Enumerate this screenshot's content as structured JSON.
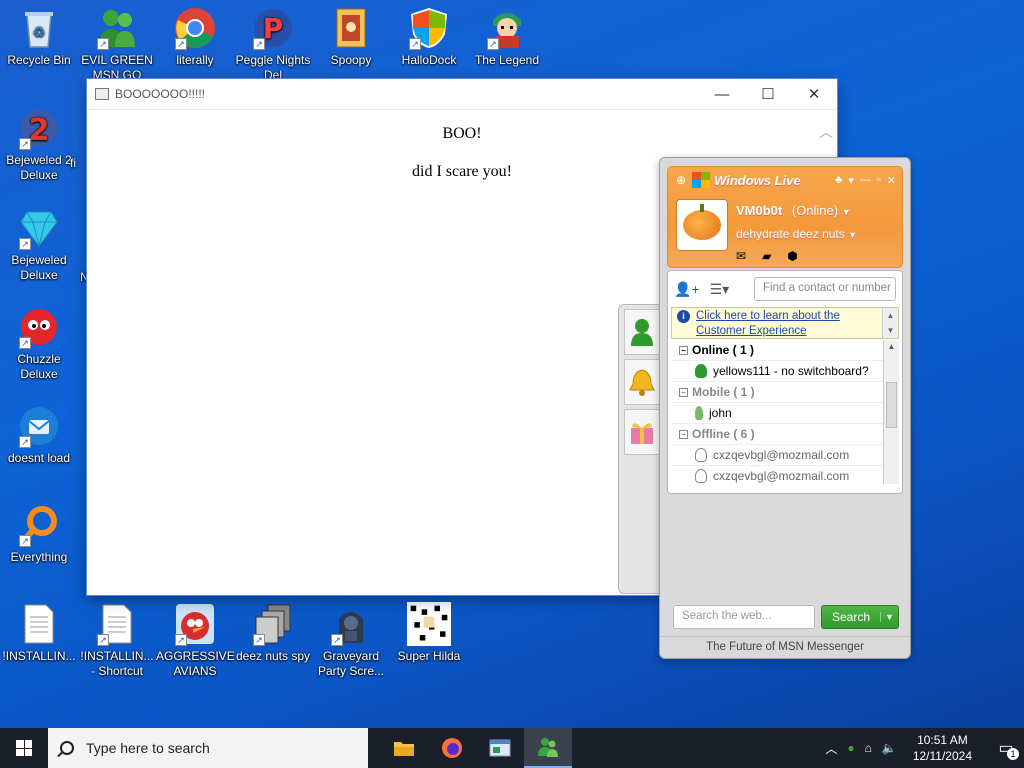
{
  "desktop": {
    "icons": [
      {
        "label": "Recycle Bin",
        "icon": "recycle-bin-icon"
      },
      {
        "label": "EVIL GREEN MSN GO",
        "icon": "msn-buddy-icon"
      },
      {
        "label": "literally",
        "icon": "chrome-icon"
      },
      {
        "label": "Peggle Nights Del",
        "icon": "peggle-icon"
      },
      {
        "label": "Spoopy",
        "icon": "spoopy-icon"
      },
      {
        "label": "HalloDock",
        "icon": "windows-shield-icon"
      },
      {
        "label": "The Legend",
        "icon": "legend-character-icon"
      },
      {
        "label": "Bejeweled 2 Deluxe",
        "icon": "bejeweled2-icon"
      },
      {
        "label": "Bejeweled Deluxe",
        "icon": "diamond-icon"
      },
      {
        "label": "Chuzzle Deluxe",
        "icon": "chuzzle-icon"
      },
      {
        "label": "doesnt load",
        "icon": "thunderbird-icon"
      },
      {
        "label": "Everything",
        "icon": "everything-search-icon"
      },
      {
        "label": "!INSTALLIN...",
        "icon": "text-file-icon"
      },
      {
        "label": "!INSTALLIN... - Shortcut",
        "icon": "text-file-icon"
      },
      {
        "label": "AGGRESSIVE AVIANS",
        "icon": "angry-bird-icon"
      },
      {
        "label": "deez nuts spy",
        "icon": "stacked-windows-icon"
      },
      {
        "label": "Graveyard Party Scre...",
        "icon": "graveyard-icon"
      },
      {
        "label": "Super Hilda",
        "icon": "pixel-art-icon"
      }
    ],
    "partial_labels": [
      "fi",
      "N"
    ]
  },
  "boo_window": {
    "title": "BOOOOOOO!!!!!",
    "heading": "BOO!",
    "body": "did I scare you!",
    "controls": {
      "minimize": "—",
      "maximize": "☐",
      "close": "✕"
    }
  },
  "messenger": {
    "brand": "Windows Live",
    "username": "VM0b0t",
    "status": "(Online)",
    "personal_message": "dehydrate deez nuts",
    "find_placeholder": "Find a contact or number",
    "notice_link": "Click here to learn about the Customer Experience",
    "groups": [
      {
        "label": "Online ( 1 )",
        "style": "online",
        "contacts": [
          {
            "name": "yellows111 - no switchboard?",
            "state": "online"
          }
        ]
      },
      {
        "label": "Mobile ( 1 )",
        "style": "dim",
        "contacts": [
          {
            "name": "john",
            "state": "mobile"
          }
        ]
      },
      {
        "label": "Offline ( 6 )",
        "style": "dim",
        "contacts": [
          {
            "name": "cxzqevbgl@mozmail.com",
            "state": "offline"
          },
          {
            "name": "cxzqevbgl@mozmail.com",
            "state": "offline"
          }
        ]
      }
    ],
    "web_search_placeholder": "Search the web...",
    "search_button": "Search",
    "footer": "The Future of MSN Messenger",
    "colors": {
      "header": "#f39a3a",
      "search_button": "#2f9a2a",
      "link": "#1d4aa8"
    }
  },
  "taskbar": {
    "search_placeholder": "Type here to search",
    "apps": [
      "file-explorer-icon",
      "firefox-icon",
      "window-app-icon",
      "msn-messenger-icon"
    ],
    "time": "10:51 AM",
    "date": "12/11/2024",
    "notification_count": "1"
  }
}
